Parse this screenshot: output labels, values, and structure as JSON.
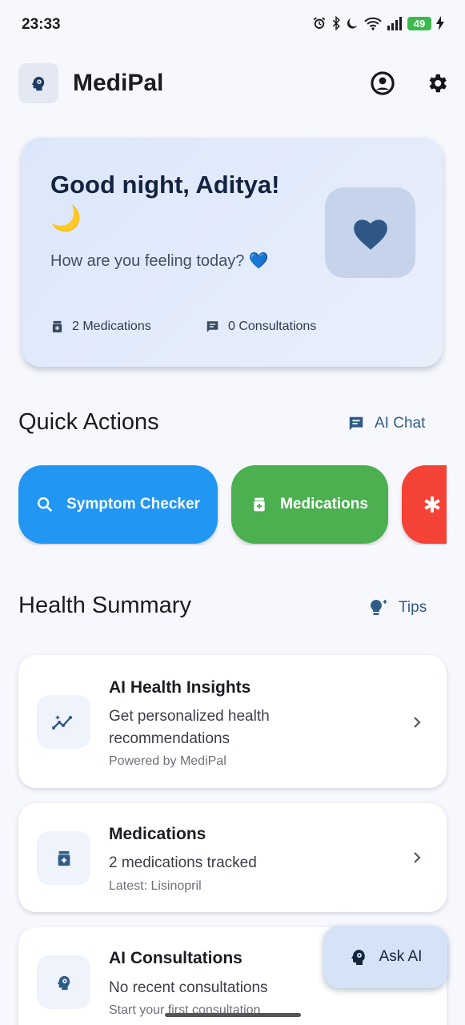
{
  "status_bar": {
    "time": "23:33",
    "battery": "49"
  },
  "app_bar": {
    "title": "MediPal"
  },
  "greeting": {
    "title": "Good night, Aditya! 🌙",
    "subtitle": "How are you feeling today? 💙",
    "medications_stat": "2 Medications",
    "consultations_stat": "0 Consultations"
  },
  "quick_actions": {
    "title": "Quick Actions",
    "link": "AI Chat",
    "buttons": [
      {
        "label": "Symptom Checker",
        "color": "#2196f3",
        "icon": "search-icon"
      },
      {
        "label": "Medications",
        "color": "#4caf50",
        "icon": "medication-icon"
      },
      {
        "label": "",
        "color": "#f44336",
        "icon": "asterisk-icon"
      }
    ]
  },
  "health_summary": {
    "title": "Health Summary",
    "link": "Tips",
    "cards": [
      {
        "title": "AI Health Insights",
        "desc": "Get personalized health recommendations",
        "meta": "Powered by MediPal",
        "icon": "insights-icon"
      },
      {
        "title": "Medications",
        "desc": "2 medications tracked",
        "meta": "Latest: Lisinopril",
        "icon": "medication-icon"
      },
      {
        "title": "AI Consultations",
        "desc": "No recent consultations",
        "meta": "Start your first consultation",
        "icon": "psychology-icon"
      }
    ]
  },
  "fab": {
    "label": "Ask AI"
  }
}
